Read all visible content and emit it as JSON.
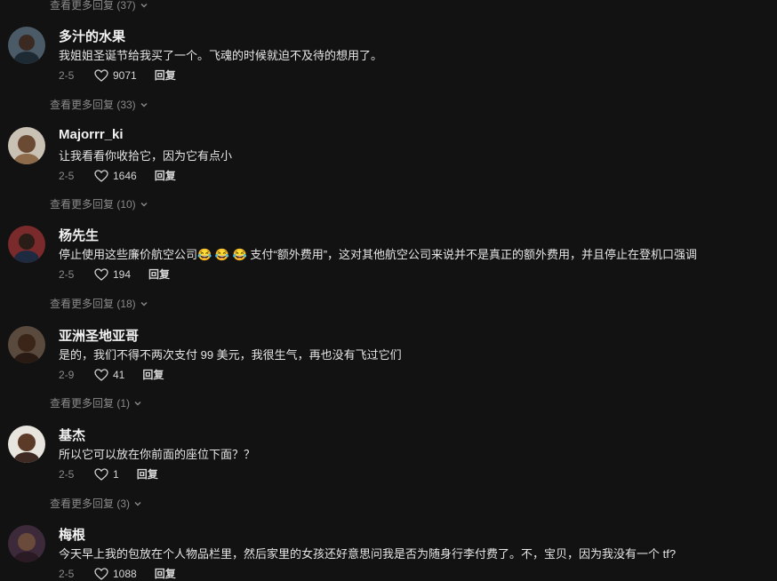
{
  "comments": [
    {
      "name": "多汁的水果",
      "text": "我姐姐圣诞节给我买了一个。飞魂的时候就迫不及待的想用了。",
      "date": "2-5",
      "likes": "9071",
      "reply": "回复",
      "more": "查看更多回复 (33)"
    },
    {
      "name": "Majorrr_ki",
      "text": "让我看看你收拾它，因为它有点小",
      "date": "2-5",
      "likes": "1646",
      "reply": "回复",
      "more": "查看更多回复 (10)"
    },
    {
      "name": "杨先生",
      "text": "停止使用这些廉价航空公司😂 😂 😂 支付“额外费用”，这对其他航空公司来说并不是真正的额外费用，并且停止在登机口强调",
      "date": "2-5",
      "likes": "194",
      "reply": "回复",
      "more": "查看更多回复 (18)"
    },
    {
      "name": "亚洲圣地亚哥",
      "text": "是的，我们不得不两次支付 99 美元，我很生气，再也没有飞过它们",
      "date": "2-9",
      "likes": "41",
      "reply": "回复",
      "more": "查看更多回复 (1)"
    },
    {
      "name": "基杰",
      "text": "所以它可以放在你前面的座位下面？？",
      "date": "2-5",
      "likes": "1",
      "reply": "回复",
      "more": "查看更多回复 (3)"
    },
    {
      "name": "梅根",
      "text": "今天早上我的包放在个人物品栏里，然后家里的女孩还好意思问我是否为随身行李付费了。不，宝贝，因为我没有一个 tf?",
      "date": "2-5",
      "likes": "1088",
      "reply": "回复"
    }
  ],
  "top_more": "查看更多回复 (37)",
  "icons": {
    "like": "heart-outline-icon",
    "expand": "chevron-down-icon"
  }
}
